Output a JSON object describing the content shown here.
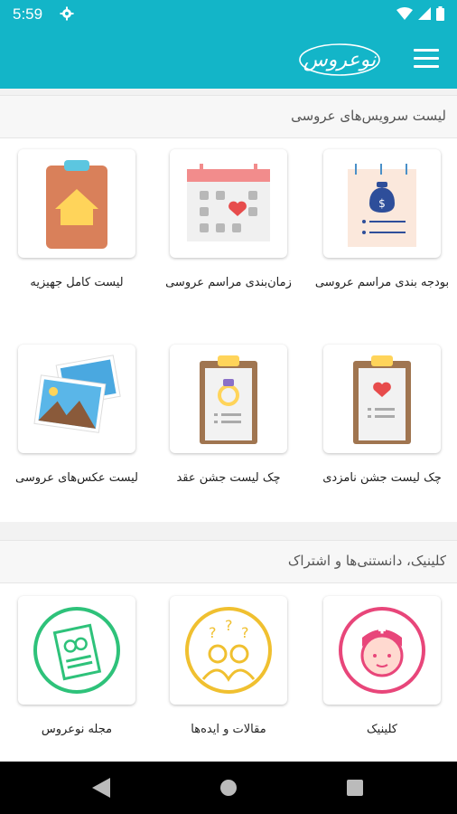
{
  "status_bar": {
    "time": "5:59"
  },
  "app_bar": {
    "logo_text": "نوعروس"
  },
  "sections": [
    {
      "title": "لیست سرویس‌های عروسی",
      "items": [
        {
          "label": "بودجه بندی مراسم عروسی",
          "icon": "budget-icon"
        },
        {
          "label": "زمان‌بندی مراسم عروسی",
          "icon": "calendar-icon"
        },
        {
          "label": "لیست کامل جهیزیه",
          "icon": "dowry-list-icon"
        },
        {
          "label": "چک لیست جشن نامزدی",
          "icon": "engagement-checklist-icon"
        },
        {
          "label": "چک لیست جشن عقد",
          "icon": "wedding-ring-checklist-icon"
        },
        {
          "label": "لیست عکس‌های عروسی",
          "icon": "photos-icon"
        }
      ]
    },
    {
      "title": "کلینیک، دانستنی‌ها و اشتراک",
      "items": [
        {
          "label": "کلینیک",
          "icon": "nurse-icon"
        },
        {
          "label": "مقالات و ایده‌ها",
          "icon": "ideas-icon"
        },
        {
          "label": "مجله نوعروس",
          "icon": "magazine-icon"
        }
      ]
    }
  ]
}
